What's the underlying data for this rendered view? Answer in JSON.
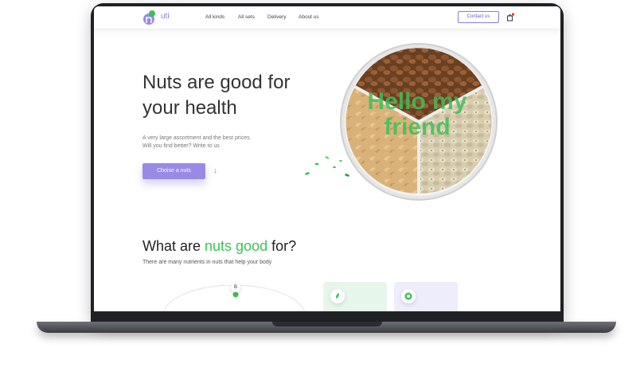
{
  "header": {
    "logo_text": "uti",
    "nav": [
      "All kinds",
      "All sets",
      "Delivery",
      "About us"
    ],
    "contact_label": "Contact us"
  },
  "hero": {
    "title_line1": "Nuts are good for",
    "title_line2": "your health",
    "subtitle_line1": "A very large assortment and the best prices.",
    "subtitle_line2": "Will you find better? Write to us",
    "cta_label": "Choise a nuts",
    "overlay_line1": "Hello my",
    "overlay_line2": "friend"
  },
  "section": {
    "title_pre": "What are ",
    "title_green": "nuts good",
    "title_post": " for?",
    "subtitle": "There are many nutrients in nuts that help your body",
    "badge": "B"
  },
  "colors": {
    "accent": "#8a7bd8",
    "green": "#3fbf58",
    "frame": "#1f2124"
  }
}
